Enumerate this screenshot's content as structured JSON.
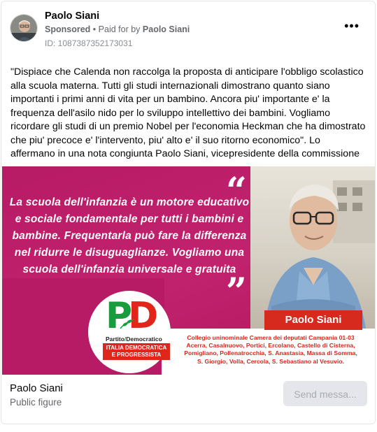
{
  "ad": {
    "advertiser_name": "Paolo Siani",
    "sponsored_label": "Sponsored",
    "separator": "•",
    "paid_for_by_label": "Paid for by",
    "paid_for_by_name": "Paolo Siani",
    "ad_id": "ID: 1087387352173031",
    "more_label": "•••",
    "body_text": "\"Dispiace che Calenda non raccolga la proposta di anticipare l'obbligo scolastico alla scuola materna. Tutti gli studi internazionali dimostrano quanto siano importanti i primi anni di vita per un bambino. Ancora piu' importante e' la frequenza dell'asilo nido per lo sviluppo intellettivo dei bambini. Vogliamo ricordare gli studi di un premio Nobel per l'economia Heckman che ha dimostrato che piu' precoce e' l'intervento, piu' alto e' il suo ritorno economico\". Lo affermano in una nota congiunta Paolo Siani, vicepresidente della commissione Infanzia, e Paolo..."
  },
  "creative": {
    "quote_open": "“",
    "quote_close": "”",
    "quote_text": "La scuola dell'infanzia è un motore educativo e sociale fondamentale per tutti i bambini e bambine. Frequentarla può fare la differenza nel ridurre le disuguaglianze. Vogliamo una scuola dell'infanzia universale e gratuita",
    "name_banner": "Paolo Siani",
    "logo_p": "P",
    "logo_d": "D",
    "logo_wordmark_left": "Partito",
    "logo_wordmark_slash": "/",
    "logo_wordmark_right": "Democratico",
    "logo_subtitle_line1": "ITALIA DEMOCRATICA",
    "logo_subtitle_line2": "E PROGRESSISTA",
    "college_line1": "Collegio uninominale Camera dei deputati Campania 01-03",
    "college_line2": "Acerra, Casalnuovo, Portici, Ercolano, Castello di Cisterna,",
    "college_line3": "Pomigliano, Pollenatrocchia, S. Anastasia, Massa di Somma,",
    "college_line4": "S. Giorgio, Volla, Cercola, S. Sebastiano al Vesuvio.",
    "colors": {
      "magenta": "#b81b66",
      "red": "#d62a1e",
      "green": "#1a9c3e"
    }
  },
  "footer": {
    "page_name": "Paolo Siani",
    "page_category": "Public figure",
    "send_button": "Send messa..."
  }
}
